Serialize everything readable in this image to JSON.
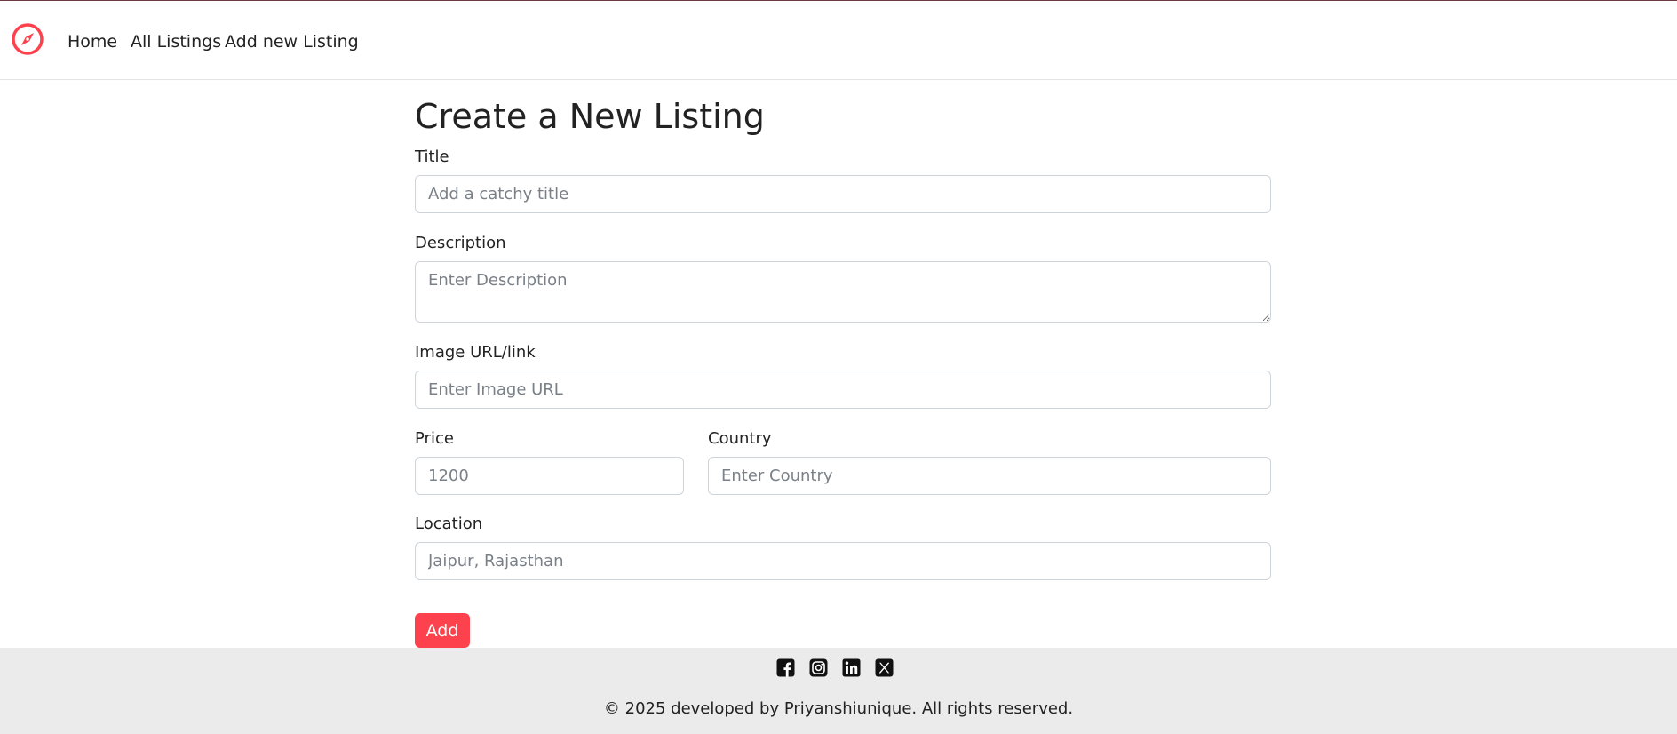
{
  "navbar": {
    "brand_icon": "compass-icon",
    "accent_color": "#fe424d",
    "links": [
      {
        "label": "Home"
      },
      {
        "label": "All Listings"
      },
      {
        "label": "Add new Listing"
      }
    ]
  },
  "form": {
    "heading": "Create a New Listing",
    "title": {
      "label": "Title",
      "placeholder": "Add a catchy title",
      "value": ""
    },
    "description": {
      "label": "Description",
      "placeholder": "Enter Description",
      "value": ""
    },
    "image": {
      "label": "Image URL/link",
      "placeholder": "Enter Image URL",
      "value": ""
    },
    "price": {
      "label": "Price",
      "placeholder": "1200",
      "value": ""
    },
    "country": {
      "label": "Country",
      "placeholder": "Enter Country",
      "value": ""
    },
    "location": {
      "label": "Location",
      "placeholder": "Jaipur, Rajasthan",
      "value": ""
    },
    "submit_label": "Add",
    "submit_color": "#fe424d"
  },
  "footer": {
    "social_icons": [
      "facebook-icon",
      "instagram-icon",
      "linkedin-icon",
      "x-twitter-icon"
    ],
    "copyright": "© 2025 developed by Priyanshiunique. All rights reserved.",
    "background": "#ebebeb"
  }
}
